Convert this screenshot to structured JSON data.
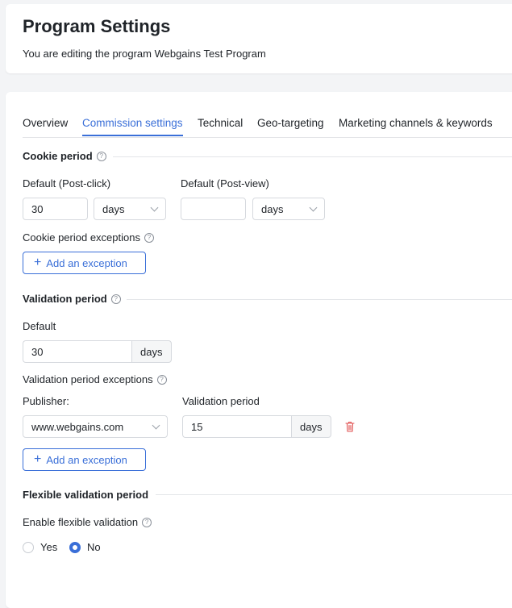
{
  "header": {
    "title": "Program Settings",
    "subtitle": "You are editing the program Webgains Test Program"
  },
  "tabs": [
    {
      "label": "Overview",
      "active": false
    },
    {
      "label": "Commission settings",
      "active": true
    },
    {
      "label": "Technical",
      "active": false
    },
    {
      "label": "Geo-targeting",
      "active": false
    },
    {
      "label": "Marketing channels & keywords",
      "active": false
    }
  ],
  "cookie_period": {
    "title": "Cookie period",
    "post_click_label": "Default (Post-click)",
    "post_click_value": "30",
    "post_click_unit": "days",
    "post_view_label": "Default (Post-view)",
    "post_view_value": "",
    "post_view_unit": "days",
    "exceptions_label": "Cookie period exceptions",
    "add_exception_label": "Add an exception"
  },
  "validation_period": {
    "title": "Validation period",
    "default_label": "Default",
    "default_value": "30",
    "default_unit": "days",
    "exceptions_label": "Validation period exceptions",
    "publisher_label": "Publisher:",
    "validation_period_label": "Validation period",
    "publisher_value": "www.webgains.com",
    "exception_value": "15",
    "exception_unit": "days",
    "add_exception_label": "Add an exception"
  },
  "flexible_validation": {
    "title": "Flexible validation period",
    "enable_label": "Enable flexible validation",
    "options": [
      {
        "label": "Yes",
        "checked": false
      },
      {
        "label": "No",
        "checked": true
      }
    ]
  },
  "colors": {
    "accent": "#3a6fd8",
    "danger": "#e05252"
  }
}
